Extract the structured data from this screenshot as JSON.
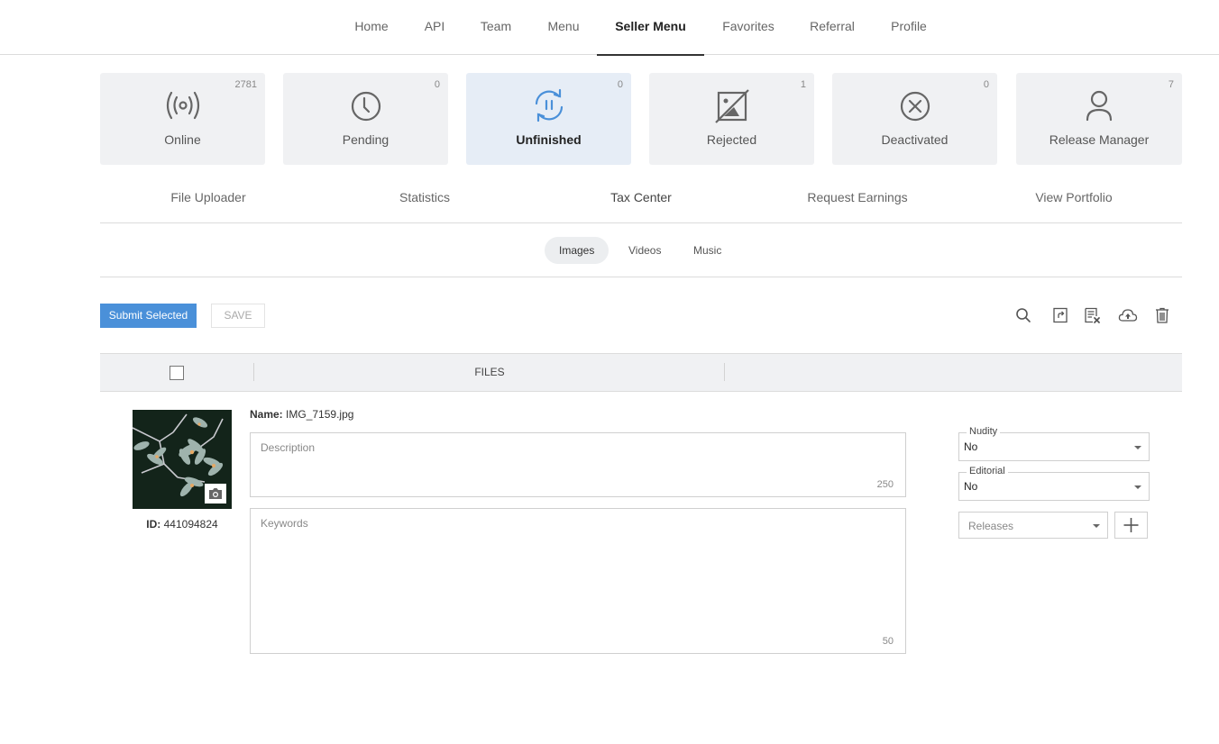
{
  "topnav": {
    "items": [
      {
        "label": "Home",
        "active": false
      },
      {
        "label": "API",
        "active": false
      },
      {
        "label": "Team",
        "active": false
      },
      {
        "label": "Menu",
        "active": false
      },
      {
        "label": "Seller Menu",
        "active": true
      },
      {
        "label": "Favorites",
        "active": false
      },
      {
        "label": "Referral",
        "active": false
      },
      {
        "label": "Profile",
        "active": false
      }
    ]
  },
  "status_cards": [
    {
      "label": "Online",
      "count": "2781",
      "icon": "broadcast-icon",
      "active": false
    },
    {
      "label": "Pending",
      "count": "0",
      "icon": "clock-icon",
      "active": false
    },
    {
      "label": "Unfinished",
      "count": "0",
      "icon": "sync-pause-icon",
      "active": true
    },
    {
      "label": "Rejected",
      "count": "1",
      "icon": "image-crossed-icon",
      "active": false
    },
    {
      "label": "Deactivated",
      "count": "0",
      "icon": "circle-x-icon",
      "active": false
    },
    {
      "label": "Release Manager",
      "count": "7",
      "icon": "user-icon",
      "active": false
    }
  ],
  "subnav": {
    "links": [
      "File Uploader",
      "Statistics",
      "Tax Center",
      "Request Earnings",
      "View Portfolio"
    ]
  },
  "media_tabs": [
    {
      "label": "Images",
      "active": true
    },
    {
      "label": "Videos",
      "active": false
    },
    {
      "label": "Music",
      "active": false
    }
  ],
  "toolbar": {
    "submit_label": "Submit Selected",
    "save_label": "SAVE",
    "icons": [
      "search-icon",
      "rotate-icon",
      "clear-list-icon",
      "cloud-upload-icon",
      "trash-icon"
    ]
  },
  "table": {
    "files_header": "FILES"
  },
  "file": {
    "name_label": "Name:",
    "name": "IMG_7159.jpg",
    "id_label": "ID:",
    "id": "441094824",
    "description_placeholder": "Description",
    "description_limit": "250",
    "keywords_placeholder": "Keywords",
    "keywords_limit": "50",
    "nudity_label": "Nudity",
    "nudity_value": "No",
    "editorial_label": "Editorial",
    "editorial_value": "No",
    "releases_placeholder": "Releases"
  },
  "colors": {
    "accent": "#4a90d9",
    "card_bg": "#f0f1f3",
    "card_active_bg": "#e6edf6"
  }
}
